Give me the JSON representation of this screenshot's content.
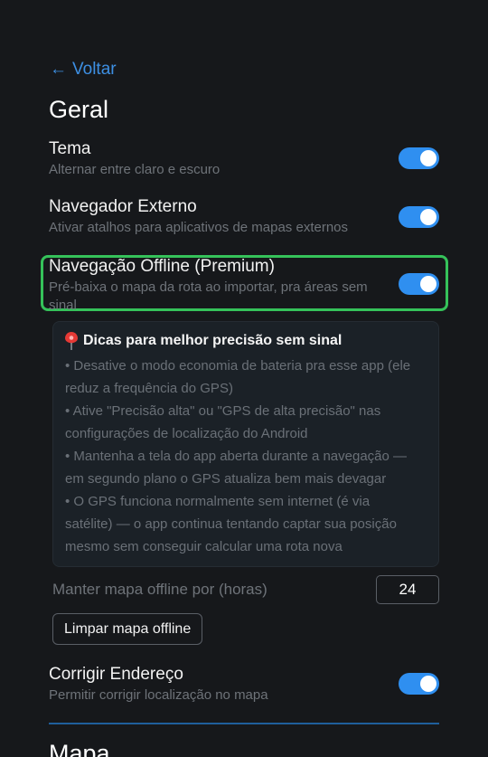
{
  "back": {
    "arrow": "←",
    "label": "Voltar"
  },
  "geral": {
    "title": "Geral",
    "settings": [
      {
        "label": "Tema",
        "description": "Alternar entre claro e escuro",
        "enabled": true
      },
      {
        "label": "Navegador Externo",
        "description": "Ativar atalhos para aplicativos de mapas externos",
        "enabled": true
      },
      {
        "label": "Navegação Offline (Premium)",
        "description": "Pré-baixa o mapa da rota ao importar, pra áreas sem sinal",
        "enabled": true
      }
    ]
  },
  "tips": {
    "icon": "pin-icon",
    "title": "Dicas para melhor precisão sem sinal",
    "items": [
      "• Desative o modo economia de bateria pra esse app (ele",
      "reduz a frequência do GPS)",
      "• Ative \"Precisão alta\" ou \"GPS de alta precisão\" nas",
      "configurações de localização do Android",
      "• Mantenha a tela do app aberta durante a navegação —",
      "em segundo plano o GPS atualiza bem mais devagar",
      "• O GPS funciona normalmente sem internet (é via",
      "satélite) — o app continua tentando captar sua posição",
      "mesmo sem conseguir calcular uma rota nova"
    ]
  },
  "offline_map": {
    "keep_label": "Manter mapa offline por (horas)",
    "hours_value": "24",
    "clear_button": "Limpar mapa offline"
  },
  "address": {
    "label": "Corrigir Endereço",
    "description": "Permitir corrigir localização no mapa",
    "enabled": true
  },
  "mapa": {
    "title": "Mapa"
  },
  "colors": {
    "accent": "#2f8ff0",
    "highlight_border": "#35c25a",
    "background": "#16181b"
  }
}
